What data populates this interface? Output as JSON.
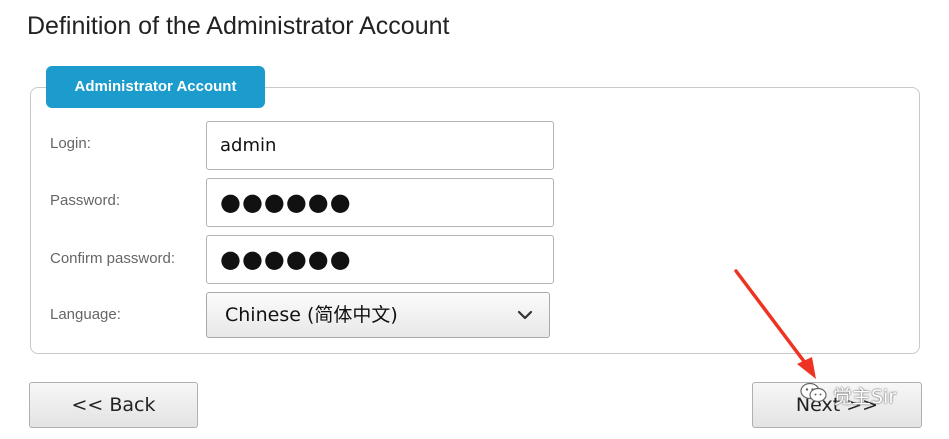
{
  "page": {
    "title": "Definition of the Administrator Account"
  },
  "admin_section": {
    "legend": "Administrator Account",
    "login": {
      "label": "Login:",
      "value": "admin"
    },
    "password": {
      "label": "Password:",
      "masked_value": "●●●●●●"
    },
    "confirm_password": {
      "label": "Confirm password:",
      "masked_value": "●●●●●●"
    },
    "language": {
      "label": "Language:",
      "selected": "Chinese (简体中文)"
    }
  },
  "buttons": {
    "back_label": "<< Back",
    "next_label": "Next >>"
  },
  "watermark": {
    "text": "觉主Sir",
    "icon": "wechat-icon"
  },
  "annotation": {
    "arrow_color": "#ee3322"
  },
  "colors": {
    "legend_bg": "#1b9ccc"
  }
}
